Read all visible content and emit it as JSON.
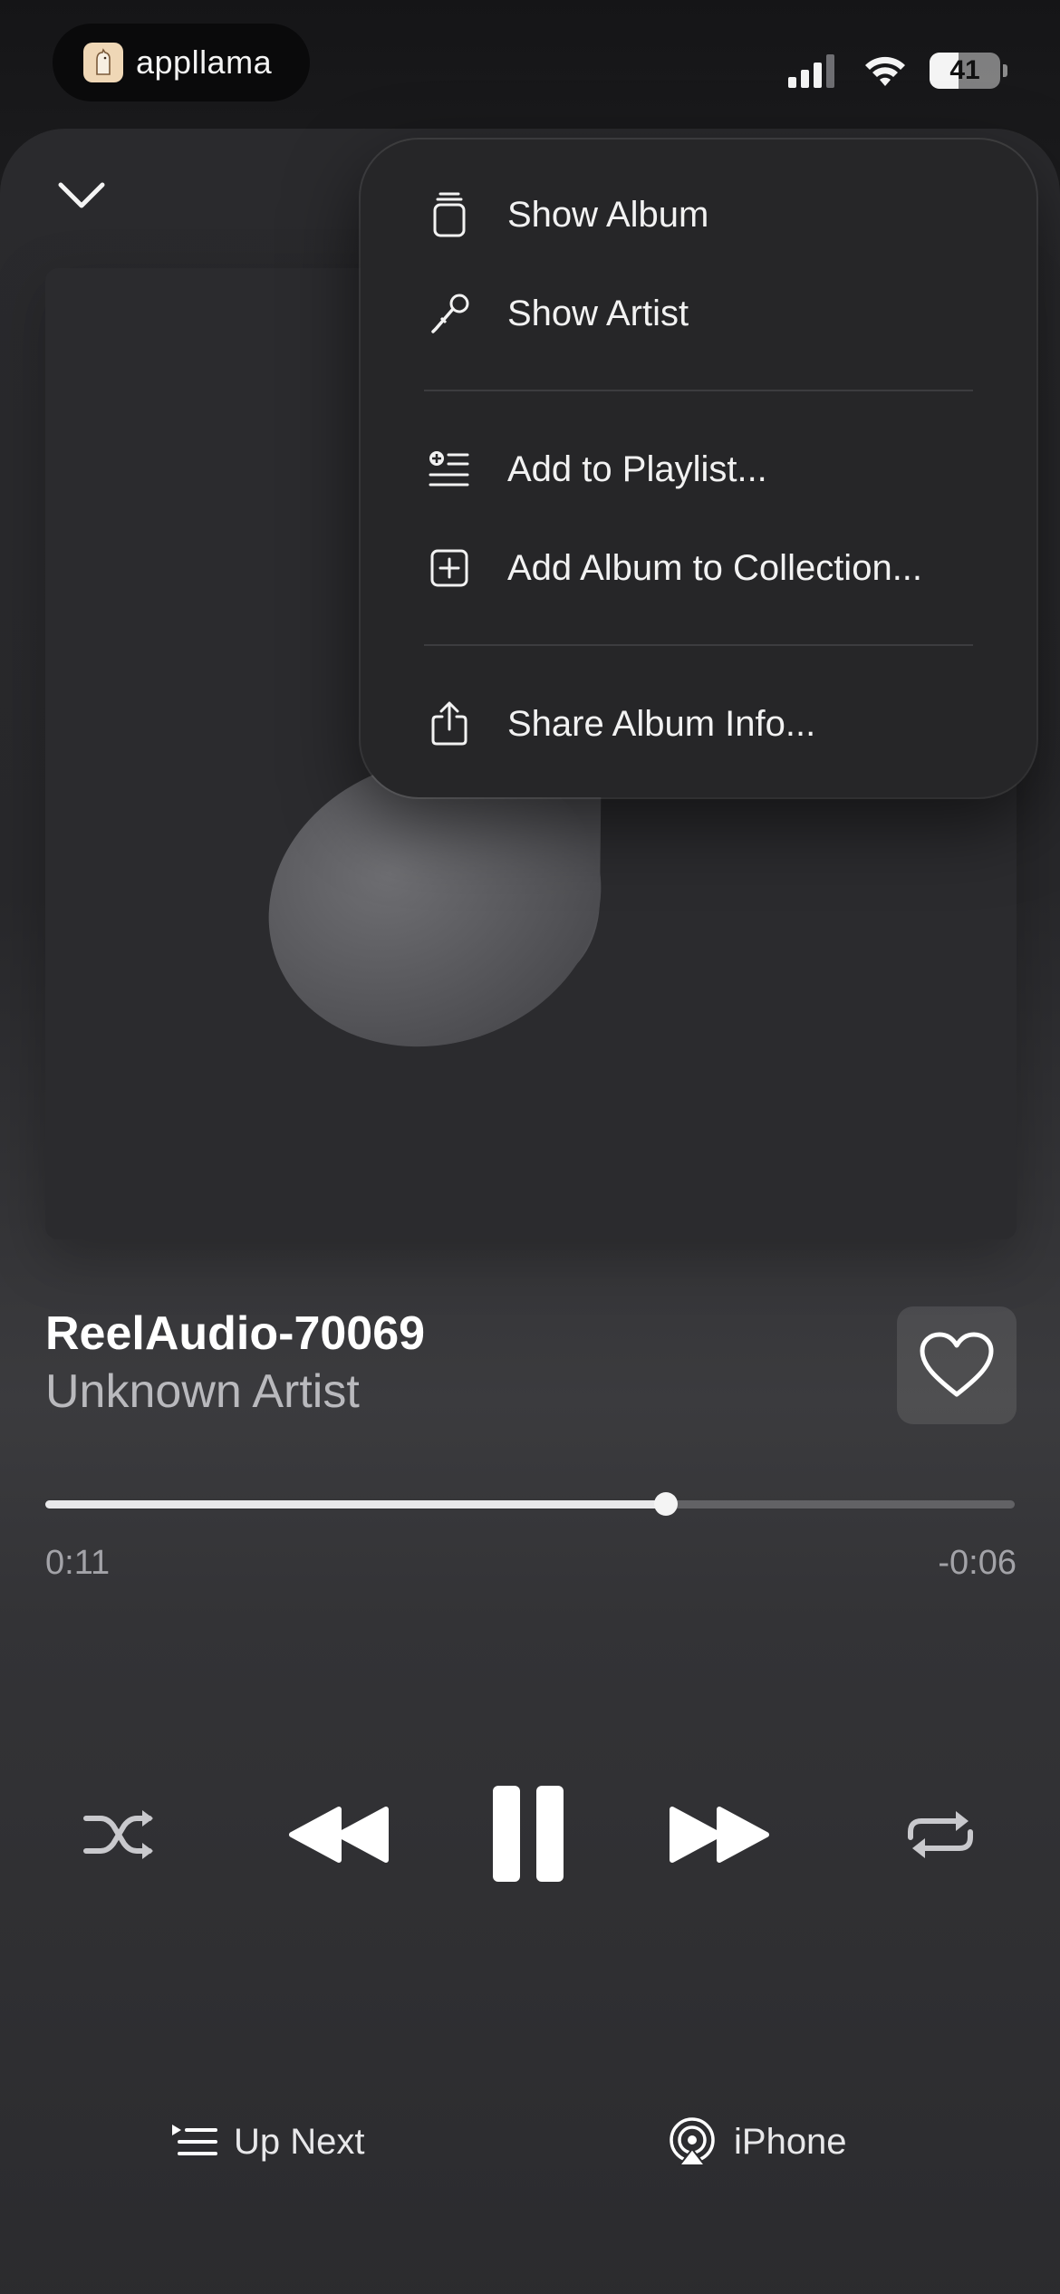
{
  "status_bar": {
    "app_name": "appllama",
    "battery_level": "41",
    "battery_fraction": 0.41
  },
  "context_menu": {
    "items": [
      {
        "label": "Show Album",
        "icon": "album-icon"
      },
      {
        "label": "Show Artist",
        "icon": "microphone-icon"
      },
      {
        "label": "Add to Playlist...",
        "icon": "add-to-playlist-icon"
      },
      {
        "label": "Add Album to Collection...",
        "icon": "plus-square-icon"
      },
      {
        "label": "Share Album Info...",
        "icon": "share-icon"
      }
    ]
  },
  "now_playing": {
    "title": "ReelAudio-70069",
    "artist": "Unknown Artist",
    "elapsed": "0:11",
    "remaining": "-0:06",
    "progress_fraction": 0.64,
    "artwork_icon": "music-note-icon"
  },
  "controls": {
    "shuffle_icon": "shuffle-icon",
    "previous_icon": "rewind-icon",
    "play_pause_icon": "pause-icon",
    "next_icon": "fast-forward-icon",
    "repeat_icon": "repeat-icon"
  },
  "bottom_bar": {
    "up_next_label": "Up Next",
    "output_label": "iPhone"
  },
  "colors": {
    "accent": "#ffffff",
    "menu_background": "#262628",
    "secondary_text": "#b9b9bd"
  }
}
